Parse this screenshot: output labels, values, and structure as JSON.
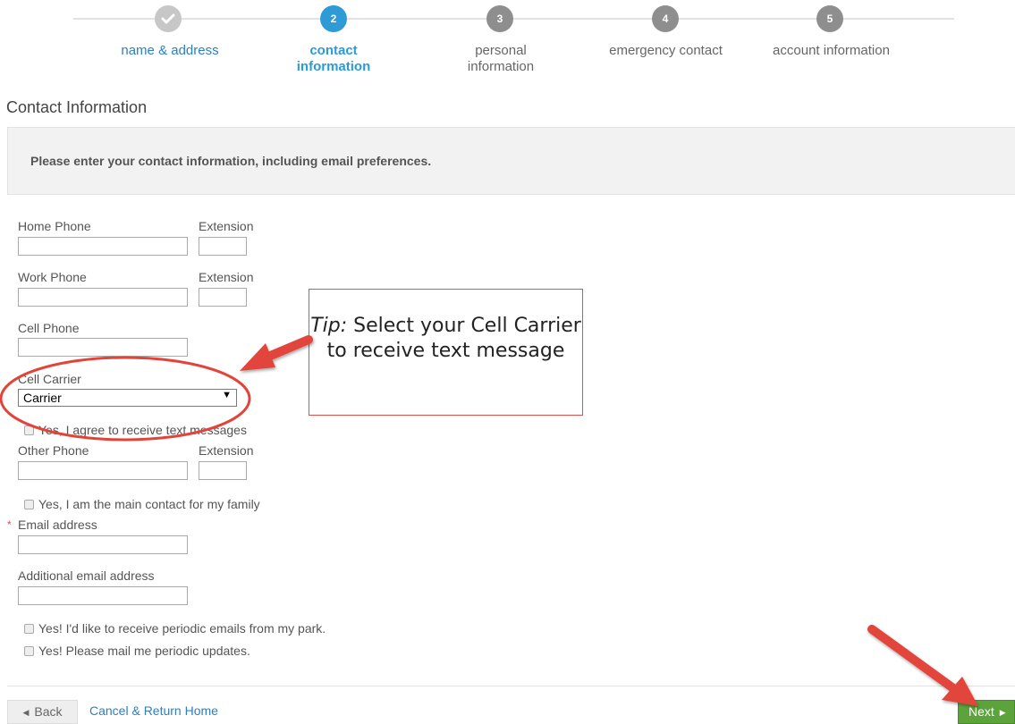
{
  "steps": [
    {
      "num": "✓",
      "label": "name & address"
    },
    {
      "num": "2",
      "label": "contact information"
    },
    {
      "num": "3",
      "label": "personal information"
    },
    {
      "num": "4",
      "label": "emergency contact"
    },
    {
      "num": "5",
      "label": "account information"
    }
  ],
  "section_title": "Contact Information",
  "intro_text": "Please enter your contact information, including email preferences.",
  "form": {
    "home_phone_label": "Home Phone",
    "extension_label": "Extension",
    "work_phone_label": "Work Phone",
    "cell_phone_label": "Cell Phone",
    "cell_carrier_label": "Cell Carrier",
    "cell_carrier_value": "Carrier",
    "text_consent_label": "Yes, I agree to receive text messages",
    "other_phone_label": "Other Phone",
    "main_contact_label": "Yes, I am the main contact for my family",
    "required_marker": "*",
    "email_label": "Email address",
    "additional_email_label": "Additional email address",
    "park_emails_label": "Yes! I'd like to receive periodic emails from my park.",
    "mail_updates_label": "Yes! Please mail me periodic updates."
  },
  "tip": {
    "prefix": "Tip:",
    "text": "Select your Cell Carrier to receive text message"
  },
  "footer": {
    "back_label": "Back",
    "cancel_label": "Cancel & Return Home",
    "next_label": "Next"
  },
  "colors": {
    "accent": "#2e9bd6",
    "next_button": "#5ca33c",
    "annotation_red": "#e2443a"
  }
}
